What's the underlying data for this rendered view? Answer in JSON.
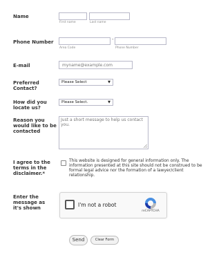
{
  "fields": {
    "name": {
      "label": "Name",
      "first_sub": "First name",
      "last_sub": "Last name"
    },
    "phone": {
      "label": "Phone Number",
      "separator": "-",
      "area_sub": "Area Code",
      "number_sub": "Phone Number"
    },
    "email": {
      "label": "E-mail",
      "placeholder": "myname@example.com"
    },
    "preferred_contact": {
      "label": "Preferred Contact?",
      "selected": "Please Select"
    },
    "how_locate": {
      "label": "How did you locate us?",
      "selected": "Please Select."
    },
    "reason": {
      "label": "Reason you would like to be contacted",
      "placeholder": "Just a short message to help us contact you."
    },
    "agree": {
      "label": "I agree to the terms in the disclaimer.*",
      "text": "This website is designed for general information only. The information presented at this site should not be construed to be formal legal advice nor the formation of a lawyer/client relationship."
    },
    "captcha": {
      "label": "Enter the message as it's shown",
      "checkbox_text": "I'm not a robot",
      "brand": "reCAPTCHA"
    }
  },
  "buttons": {
    "send": "Send",
    "clear": "Clear Form"
  },
  "icons": {
    "select_arrow": "chevron-down-icon",
    "recaptcha_logo": "recaptcha-logo-icon"
  },
  "colors": {
    "recaptcha_blue": "#4a90e2",
    "recaptcha_gray": "#b8b8b8",
    "border": "#b8b8c8"
  }
}
